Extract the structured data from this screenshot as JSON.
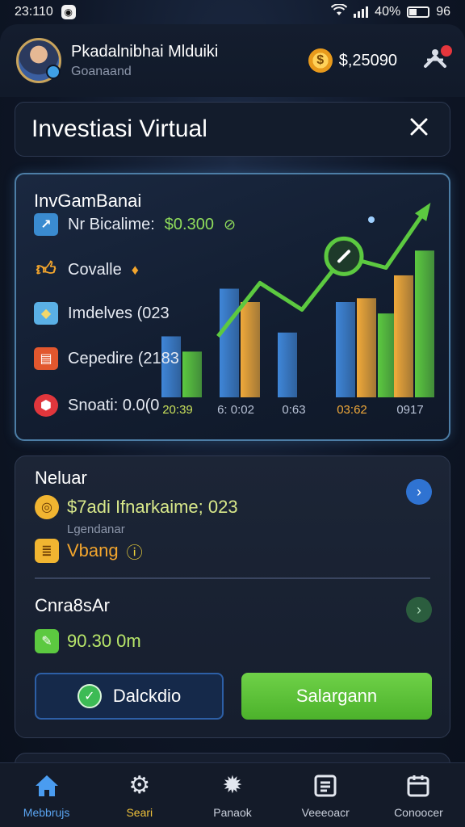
{
  "status_bar": {
    "time": "23:110",
    "battery": "40%",
    "extra": "96",
    "battery_level": 0.4
  },
  "header": {
    "user_name": "Pkadalnibhai Mlduiki",
    "user_sub": "Goanaand",
    "balance": "$,25090",
    "coin_icon": "coin-icon",
    "notification_icon": "scale-icon"
  },
  "page": {
    "title": "Investiasi Virtual",
    "close_icon": "close-icon"
  },
  "investment_card": {
    "heading": "InvGamBanai",
    "stats": [
      {
        "icon": "edit-icon",
        "label": "Nr Bicalime:",
        "value": "$0.300",
        "color": "#4aa3e0"
      },
      {
        "icon": "thumbs-up-icon",
        "label": "Covalle",
        "value": "",
        "color": "#f2a52d"
      },
      {
        "icon": "layers-icon",
        "label": "Imdelves (023",
        "value": "",
        "color": "#5ab0e6"
      },
      {
        "icon": "chart-icon",
        "label": "Cepedire (2183",
        "value": "",
        "color": "#e2572e"
      },
      {
        "icon": "shield-icon",
        "label": "Snoati: 0.0(0",
        "value": "",
        "color": "#e0363c"
      }
    ]
  },
  "chart_data": {
    "type": "bar",
    "categories": [
      "20:39",
      "6: 0:02",
      "0:63",
      "03:62",
      "0917"
    ],
    "series": [
      {
        "color": "#3f86d8",
        "values": [
          3.2,
          5.7,
          3.4,
          5.0,
          0
        ]
      },
      {
        "color": "#f0a93a",
        "values": [
          0,
          5.0,
          0,
          5.2,
          6.4
        ]
      },
      {
        "color": "#5cc940",
        "values": [
          2.4,
          0,
          0,
          4.4,
          7.7
        ]
      }
    ],
    "trend": [
      3.2,
      6.0,
      4.6,
      7.4,
      6.8,
      10.0
    ],
    "ylim": [
      0,
      10
    ],
    "xlabel": "",
    "ylabel": ""
  },
  "summary": {
    "section1_title": "Neluar",
    "section1_line": "$7adi Ifnarkaime; 023",
    "section1_sub": "Lgendanar",
    "section1_tag": "Vbang",
    "section2_title": "Cnra8sAr",
    "section2_value": "90.30 0m",
    "btn_left": "Dalckdio",
    "btn_right": "Salargann"
  },
  "nav": [
    {
      "label": "Mebbrujs",
      "icon": "home-icon",
      "active": true
    },
    {
      "label": "Seari",
      "icon": "gear-icon",
      "active": false
    },
    {
      "label": "Panaok",
      "icon": "settings-icon",
      "active": false
    },
    {
      "label": "Veeeoacr",
      "icon": "document-icon",
      "active": false
    },
    {
      "label": "Conoocer",
      "icon": "calendar-icon",
      "active": false
    }
  ]
}
